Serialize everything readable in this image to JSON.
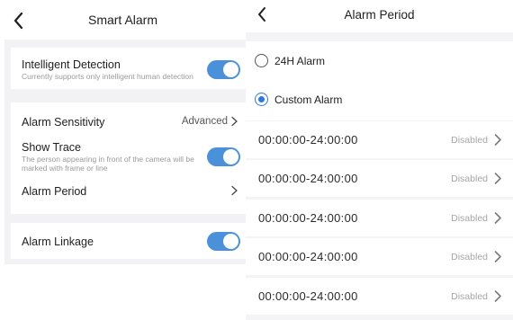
{
  "smart_alarm": {
    "title": "Smart Alarm",
    "intelligent_detection": {
      "label": "Intelligent Detection",
      "description": "Currently supports only intelligent human detection",
      "enabled": true
    },
    "alarm_sensitivity": {
      "label": "Alarm Sensitivity",
      "value": "Advanced"
    },
    "show_trace": {
      "label": "Show Trace",
      "description_line1": "The person appearing in front of the camera will be",
      "description_line2": "marked with frame or line",
      "enabled": true
    },
    "alarm_period": {
      "label": "Alarm Period"
    },
    "alarm_linkage": {
      "label": "Alarm Linkage",
      "enabled": true
    }
  },
  "alarm_period_screen": {
    "title": "Alarm Period",
    "options": [
      {
        "label": "24H Alarm",
        "selected": false
      },
      {
        "label": "Custom Alarm",
        "selected": true
      }
    ],
    "periods": [
      {
        "time": "00:00:00-24:00:00",
        "status": "Disabled"
      },
      {
        "time": "00:00:00-24:00:00",
        "status": "Disabled"
      },
      {
        "time": "00:00:00-24:00:00",
        "status": "Disabled"
      },
      {
        "time": "00:00:00-24:00:00",
        "status": "Disabled"
      },
      {
        "time": "00:00:00-24:00:00",
        "status": "Disabled"
      }
    ]
  },
  "colors": {
    "accent": "#4b91d9",
    "radio_accent": "#2f7ad8",
    "background": "#f2f2f4"
  },
  "icons": [
    "back-chevron-icon",
    "chevron-right-icon"
  ]
}
